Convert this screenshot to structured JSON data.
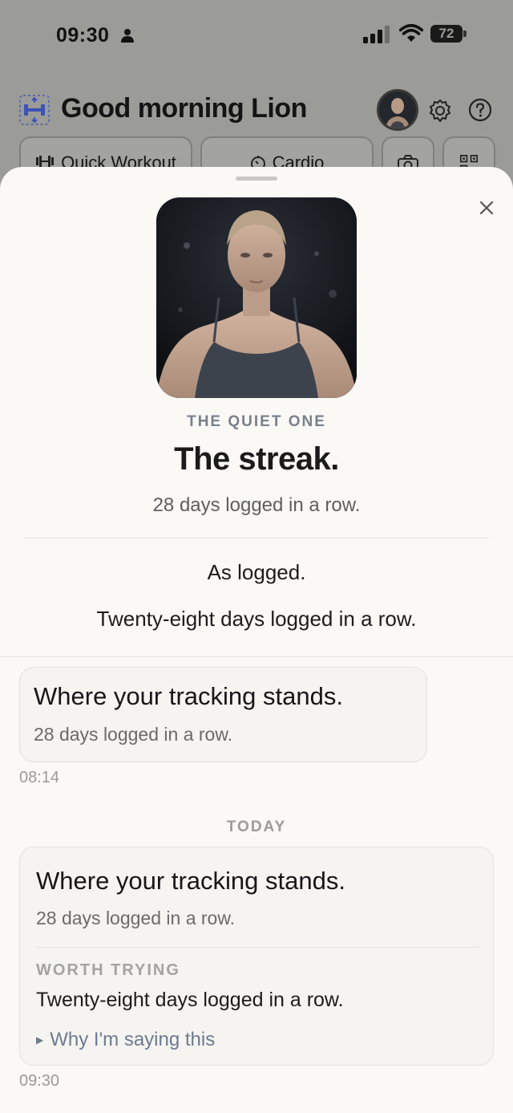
{
  "status_bar": {
    "time": "09:30",
    "battery": "72"
  },
  "header": {
    "greeting": "Good morning Lion"
  },
  "quick_actions": [
    {
      "label": "Quick Workout",
      "icon": "dumbbell-icon"
    },
    {
      "label": "Cardio",
      "icon": "timer-icon"
    },
    {
      "label": "",
      "icon": "camera-icon"
    },
    {
      "label": "",
      "icon": "qr-code-icon"
    }
  ],
  "card": {
    "persona": "THE QUIET ONE",
    "headline": "The streak.",
    "subline": "28 days logged in a row.",
    "body_line1": "As logged.",
    "body_line2": "Twenty-eight days logged in a row."
  },
  "messages": [
    {
      "title": "Where your tracking stands.",
      "subtitle": "28 days logged in a row.",
      "time": "08:14"
    },
    {
      "title": "Where your tracking stands.",
      "subtitle": "28 days logged in a row.",
      "section_label": "WORTH TRYING",
      "section_body": "Twenty-eight days logged in a row.",
      "link": "Why I'm saying this",
      "time": "09:30"
    }
  ],
  "day_separator": "TODAY",
  "colors": {
    "accent_slate": "#77808c",
    "sheet_bg": "#faf9f6",
    "logo_blue": "#3d52b5"
  }
}
